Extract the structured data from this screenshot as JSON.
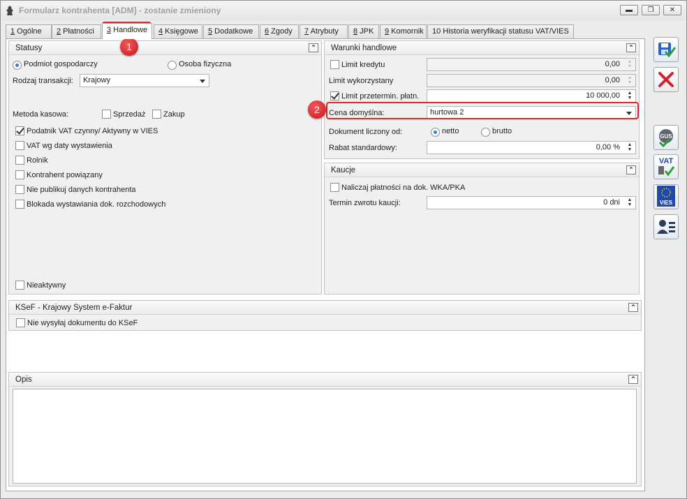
{
  "window": {
    "title": "Formularz kontrahenta [ADM] - zostanie zmieniony",
    "controls": {
      "minimize": "▬",
      "maximize": "❐",
      "close": "✕"
    }
  },
  "tabs": [
    {
      "num": "1",
      "label": " Ogólne"
    },
    {
      "num": "2",
      "label": " Płatności"
    },
    {
      "num": "3",
      "label": " Handlowe"
    },
    {
      "num": "4",
      "label": " Księgowe"
    },
    {
      "num": "5",
      "label": " Dodatkowe"
    },
    {
      "num": "6",
      "label": " Zgody"
    },
    {
      "num": "7",
      "label": " Atrybuty"
    },
    {
      "num": "8",
      "label": " JPK"
    },
    {
      "num": "9",
      "label": " Komornik"
    },
    {
      "num": "",
      "label": "10 Historia weryfikacji statusu VAT/VIES"
    }
  ],
  "statusy": {
    "header": "Statusy",
    "radio_podmiot": "Podmiot gospodarczy",
    "radio_osoba": "Osoba fizyczna",
    "rodzaj_label": "Rodzaj transakcji:",
    "rodzaj_value": "Krajowy",
    "metoda_label": "Metoda kasowa:",
    "sprzedaz": "Sprzedaż",
    "zakup": "Zakup",
    "podatnik_vat": "Podatnik VAT czynny/ Aktywny w VIES",
    "vat_daty": "VAT wg daty wystawienia",
    "rolnik": "Rolnik",
    "powiazany": "Kontrahent powiązany",
    "nie_publikuj": "Nie publikuj danych kontrahenta",
    "blokada": "Blokada wystawiania dok. rozchodowych",
    "nieaktywny": "Nieaktywny"
  },
  "warunki": {
    "header": "Warunki handlowe",
    "limit_kredytu_label": "Limit kredytu",
    "limit_kredytu_value": "0,00",
    "limit_wykorzystany_label": "Limit wykorzystany",
    "limit_wykorzystany_value": "0,00",
    "limit_przetermin_label": "Limit przetermin. płatn.",
    "limit_przetermin_value": "10 000,00",
    "cena_label": "Cena domyślna:",
    "cena_value": "hurtowa 2",
    "dokument_label": "Dokument liczony od:",
    "netto": "netto",
    "brutto": "brutto",
    "rabat_label": "Rabat standardowy:",
    "rabat_value": "0,00 %"
  },
  "kaucje": {
    "header": "Kaucje",
    "naliczaj": "Naliczaj płatności na dok. WKA/PKA",
    "termin_label": "Termin zwrotu kaucji:",
    "termin_value": "0 dni"
  },
  "ksef": {
    "header": "KSeF - Krajowy System e-Faktur",
    "nie_wysylaj": "Nie wysyłaj dokumentu do KSeF"
  },
  "opis": {
    "header": "Opis",
    "value": ""
  },
  "annotations": {
    "badge1": "1",
    "badge2": "2"
  },
  "side": {
    "vat_label": "VAT",
    "vies_label": "VIES",
    "gus_label": "GUS"
  },
  "colors": {
    "highlight": "#e0242f",
    "save": "#2a64c8",
    "cancel": "#d6202a",
    "eu": "#1f4aa8"
  }
}
